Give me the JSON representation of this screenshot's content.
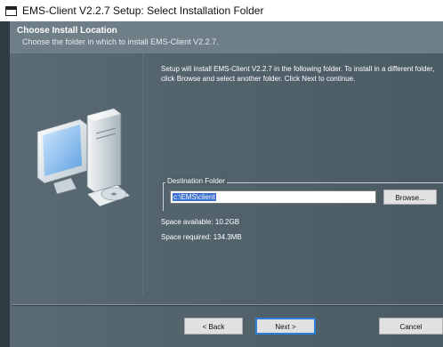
{
  "window": {
    "title": "EMS-Client V2.2.7 Setup: Select Installation Folder"
  },
  "header": {
    "title": "Choose Install Location",
    "subtitle": "Choose the folder in which to install EMS-Client V2.2.7."
  },
  "content": {
    "info": "Setup will install EMS-Client V2.2.7 in the following folder. To install in a different folder, click Browse and select another folder. Click Next to continue.",
    "destination_label": "Destination Folder",
    "destination_value": "c:\\EMS\\client",
    "browse_label": "Browse...",
    "space_available": "Space available: 10.2GB",
    "space_required": "Space required: 134.3MB"
  },
  "footer": {
    "back_label": "< Back",
    "next_label": "Next >",
    "cancel_label": "Cancel"
  },
  "icons": {
    "title": "window-icon",
    "art": "computer-install-icon"
  }
}
